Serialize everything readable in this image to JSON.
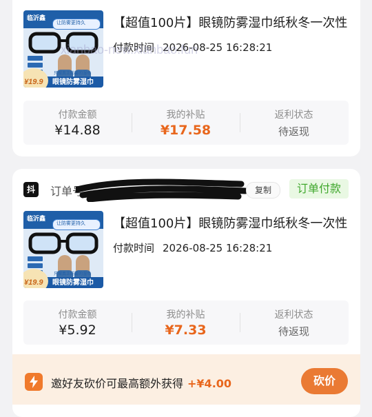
{
  "orders": [
    {
      "product": {
        "title": "【超值100片】眼镜防雾湿巾纸秋冬一次性",
        "thumb_brand": "临沂鑫",
        "thumb_slogan": "让防雾更持久",
        "thumb_footer": "眼镜防雾湿巾",
        "thumb_sub": "只做真正防雾的湿巾",
        "thumb_price": "¥19.9"
      },
      "pay_time_label": "付款时间",
      "pay_time": "2026-08-25 16:28:21",
      "stats": {
        "pay_amount_label": "付款金额",
        "pay_amount": "¥14.88",
        "subsidy_label": "我的补贴",
        "subsidy": "¥17.58",
        "rebate_label": "返利状态",
        "rebate": "待返现"
      }
    },
    {
      "platform_badge": "抖",
      "order_label": "订单号：",
      "copy_label": "复制",
      "status": "订单付款",
      "product": {
        "title": "【超值100片】眼镜防雾湿巾纸秋冬一次性",
        "thumb_brand": "临沂鑫",
        "thumb_slogan": "让防雾更持久",
        "thumb_footer": "眼镜防雾湿巾",
        "thumb_sub": "只做真正防雾的湿巾",
        "thumb_price": "¥19.9"
      },
      "pay_time_label": "付款时间",
      "pay_time": "2026-08-25 16:28:21",
      "stats": {
        "pay_amount_label": "付款金额",
        "pay_amount": "¥5.92",
        "subsidy_label": "我的补贴",
        "subsidy": "¥7.33",
        "rebate_label": "返利状态",
        "rebate": "待返现"
      }
    }
  ],
  "watermark": "xianbao-new.xianbao.fun",
  "invite": {
    "text": "邀好友砍价可最高额外获得",
    "amount": "+¥4.00",
    "button": "砍价",
    "icon": "lightning-icon"
  },
  "colors": {
    "accent": "#e8661c",
    "status_green": "#3fa72c",
    "invite_bg": "#fcefe2"
  }
}
